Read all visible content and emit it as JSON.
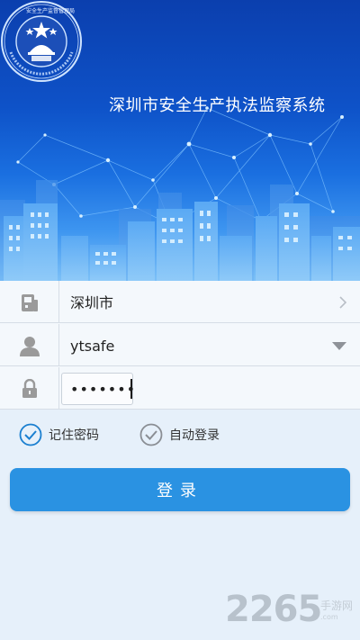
{
  "header": {
    "title": "深圳市安全生产执法监察系统",
    "emblem_ring_text": "安 全 生 产 监 督 管 理 局 · Bureau Of Work Safety Of Shenzhen"
  },
  "form": {
    "city": {
      "value": "深圳市",
      "icon": "building-icon",
      "trail_icon": "chevron-right-icon"
    },
    "username": {
      "value": "ytsafe",
      "icon": "user-icon",
      "trail_icon": "dropdown-triangle-icon"
    },
    "password": {
      "value": "•••••••",
      "icon": "lock-icon"
    }
  },
  "options": {
    "remember_password": {
      "label": "记住密码",
      "checked": true
    },
    "auto_login": {
      "label": "自动登录",
      "checked": false
    }
  },
  "login_button": {
    "label": "登录"
  },
  "watermark": {
    "number": "2265",
    "suffix": ".com",
    "site_name": "手游网"
  },
  "colors": {
    "accent": "#2a92e2",
    "banner_top": "#0b3fae",
    "background": "#e6f0fa",
    "checked": "#1a7fd0"
  }
}
